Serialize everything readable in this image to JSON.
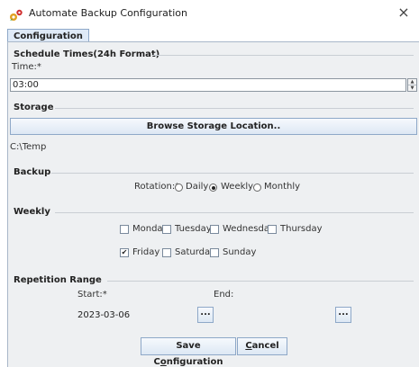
{
  "window": {
    "title": "Automate Backup Configuration",
    "close_glyph": "×",
    "app_icon": "gear-icon"
  },
  "tabs": [
    {
      "label": "Configuration",
      "selected": true
    }
  ],
  "schedule": {
    "section_title": "Schedule Times(24h Format)",
    "time_label": "Time:*",
    "time_value": "03:00"
  },
  "storage": {
    "section_title": "Storage",
    "browse_label": "Browse Storage Location..",
    "path": "C:\\Temp"
  },
  "backup": {
    "section_title": "Backup",
    "rotation_label": "Rotation:*",
    "options": [
      {
        "label": "Daily",
        "checked": false
      },
      {
        "label": "Weekly",
        "checked": true
      },
      {
        "label": "Monthly",
        "checked": false
      }
    ]
  },
  "weekly": {
    "section_title": "Weekly",
    "days": [
      {
        "label": "Monday",
        "checked": false
      },
      {
        "label": "Tuesday",
        "checked": false
      },
      {
        "label": "Wednesday",
        "checked": false
      },
      {
        "label": "Thursday",
        "checked": false
      },
      {
        "label": "Friday",
        "checked": true
      },
      {
        "label": "Saturday",
        "checked": false
      },
      {
        "label": "Sunday",
        "checked": false
      }
    ],
    "check_glyph": "✔"
  },
  "repetition": {
    "section_title": "Repetition Range",
    "start_label": "Start:*",
    "end_label": "End:",
    "start_value": "2023-03-06",
    "end_value": "",
    "picker_label": "..."
  },
  "footer": {
    "save_pre": "Save C",
    "save_key": "o",
    "save_post": "nfiguration",
    "cancel_key": "C",
    "cancel_post": "ancel"
  },
  "colors": {
    "panel_bg": "#eef0f2",
    "tab_bg": "#dfeaf7",
    "button_border": "#8ea8c8"
  }
}
